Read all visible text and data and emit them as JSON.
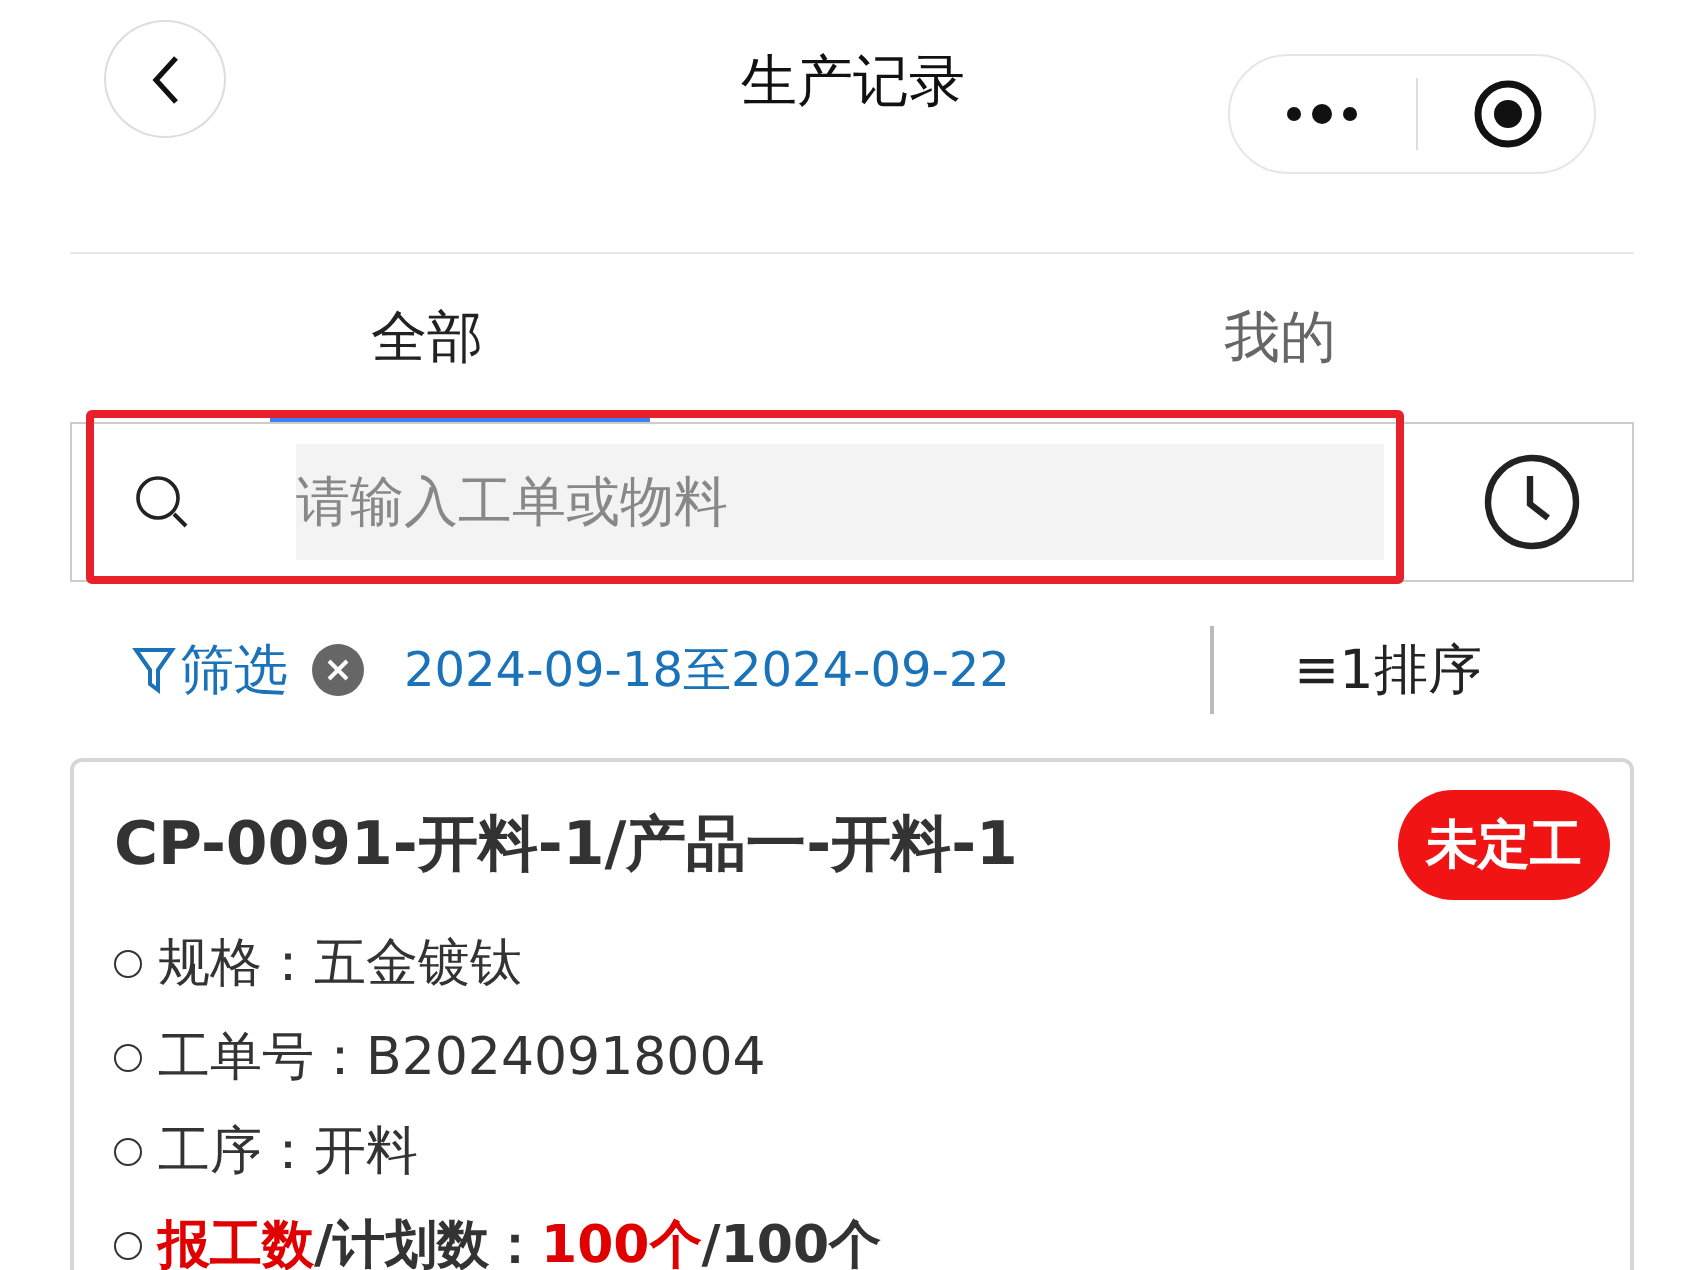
{
  "header": {
    "title": "生产记录"
  },
  "tabs": [
    {
      "label": "全部",
      "selected": true
    },
    {
      "label": "我的",
      "selected": false
    }
  ],
  "search": {
    "placeholder": "请输入工单或物料",
    "highlighted": true
  },
  "filter": {
    "label": "筛选",
    "date_range": "2024-09-18至2024-09-22",
    "sort_label": "排序",
    "sort_icon": "≡1"
  },
  "records": [
    {
      "title": "CP-0091-开料-1/产品一-开料-1",
      "status": "未定工",
      "fields": [
        {
          "label": "规格：",
          "value": "五金镀钛"
        },
        {
          "label": "工单号：",
          "value": "B20240918004"
        },
        {
          "label": "工序：",
          "value": "开料"
        }
      ],
      "quantity": [
        {
          "text": "报工数",
          "emphasis": true
        },
        {
          "text": "/计划数：",
          "emphasis": false
        },
        {
          "text": "100个",
          "emphasis": true
        },
        {
          "text": "/100个",
          "emphasis": false
        }
      ]
    }
  ]
}
